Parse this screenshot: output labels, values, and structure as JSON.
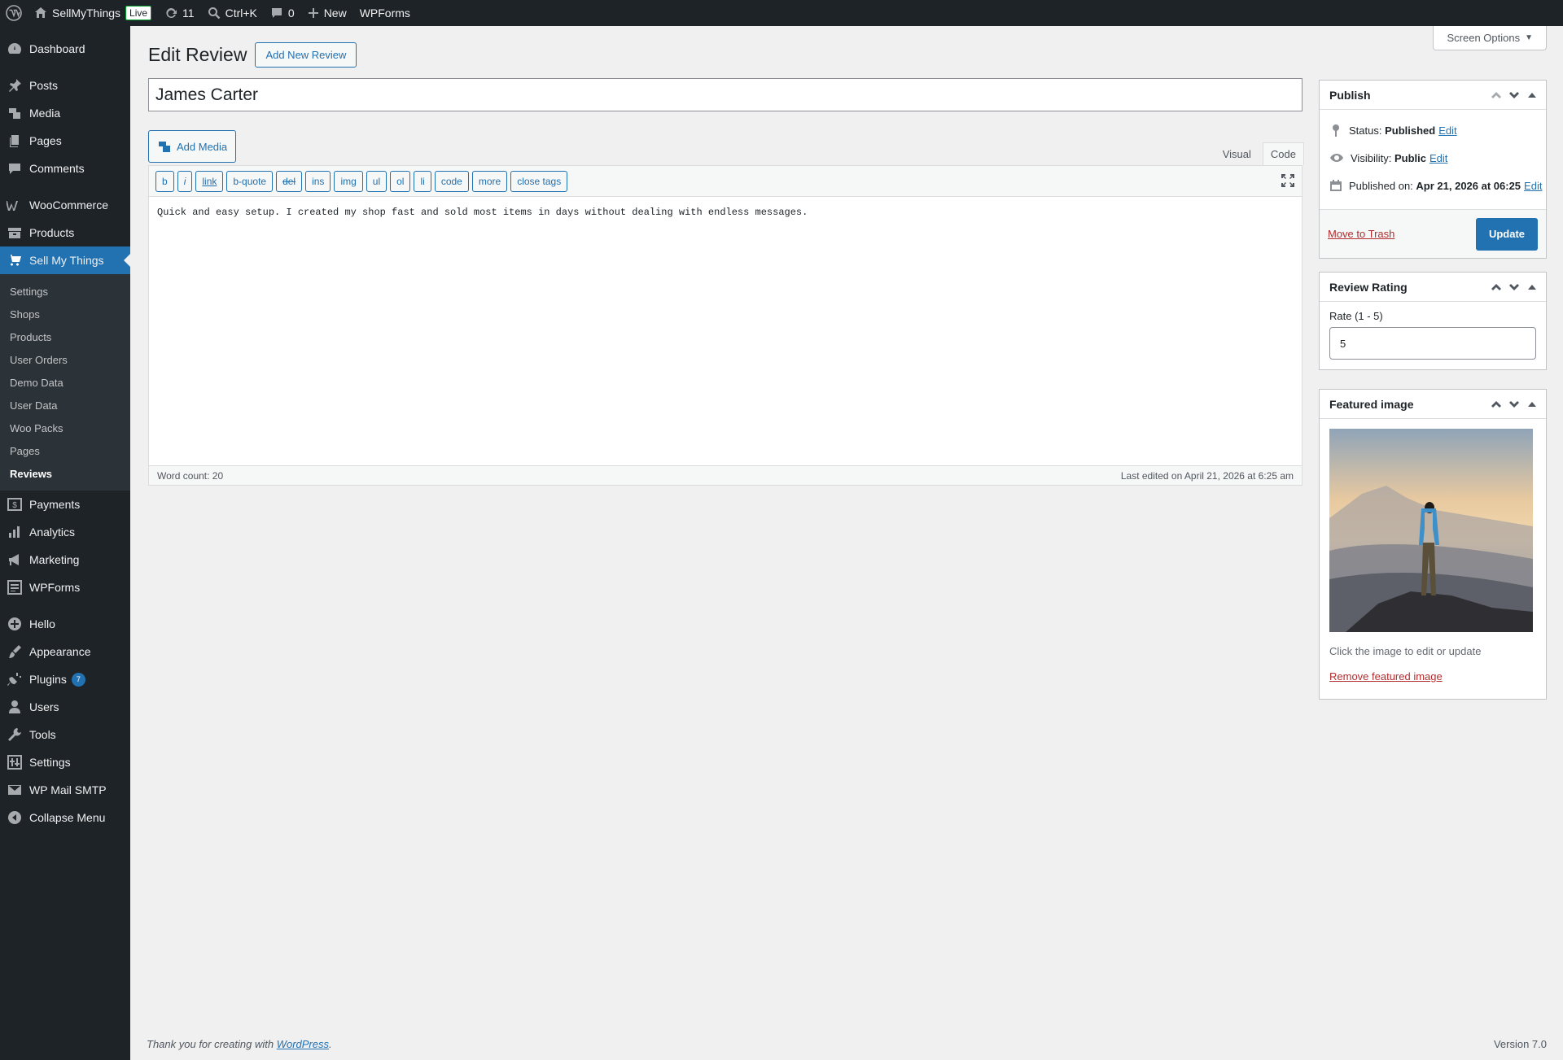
{
  "adminbar": {
    "site_name": "SellMyThings",
    "live_badge": "Live",
    "updates_count": "11",
    "search_shortcut": "Ctrl+K",
    "comments_count": "0",
    "new_label": "New",
    "wpforms_label": "WPForms"
  },
  "sidebar": {
    "items": [
      {
        "label": "Dashboard",
        "icon": "dashboard-icon"
      },
      {
        "label": "Posts",
        "icon": "pin-icon"
      },
      {
        "label": "Media",
        "icon": "media-icon"
      },
      {
        "label": "Pages",
        "icon": "pages-icon"
      },
      {
        "label": "Comments",
        "icon": "comments-icon"
      },
      {
        "label": "WooCommerce",
        "icon": "woocommerce-icon"
      },
      {
        "label": "Products",
        "icon": "archive-icon"
      },
      {
        "label": "Sell My Things",
        "icon": "cart-icon"
      },
      {
        "label": "Payments",
        "icon": "dollar-icon"
      },
      {
        "label": "Analytics",
        "icon": "chart-icon"
      },
      {
        "label": "Marketing",
        "icon": "megaphone-icon"
      },
      {
        "label": "WPForms",
        "icon": "forms-icon"
      },
      {
        "label": "Hello",
        "icon": "plus-circle-icon"
      },
      {
        "label": "Appearance",
        "icon": "brush-icon"
      },
      {
        "label": "Plugins",
        "icon": "plugin-icon",
        "badge": "7"
      },
      {
        "label": "Users",
        "icon": "users-icon"
      },
      {
        "label": "Tools",
        "icon": "wrench-icon"
      },
      {
        "label": "Settings",
        "icon": "settings-icon"
      },
      {
        "label": "WP Mail SMTP",
        "icon": "mail-icon"
      },
      {
        "label": "Collapse Menu",
        "icon": "collapse-icon"
      }
    ],
    "submenu": [
      "Settings",
      "Shops",
      "Products",
      "User Orders",
      "Demo Data",
      "User Data",
      "Woo Packs",
      "Pages",
      "Reviews"
    ]
  },
  "screen_options": "Screen Options",
  "page": {
    "title": "Edit Review",
    "add_new": "Add New Review",
    "post_title": "James Carter"
  },
  "editor": {
    "add_media": "Add Media",
    "tab_visual": "Visual",
    "tab_code": "Code",
    "buttons": [
      "b",
      "i",
      "link",
      "b-quote",
      "del",
      "ins",
      "img",
      "ul",
      "ol",
      "li",
      "code",
      "more",
      "close tags"
    ],
    "content": "Quick and easy setup. I created my shop fast and sold most items in days without dealing with endless messages.",
    "word_count": "Word count: 20",
    "last_edited": "Last edited on April 21, 2026 at 6:25 am"
  },
  "publish": {
    "title": "Publish",
    "status_label": "Status:",
    "status_value": "Published",
    "visibility_label": "Visibility:",
    "visibility_value": "Public",
    "published_label": "Published on:",
    "published_value": "Apr 21, 2026 at 06:25",
    "edit": "Edit",
    "trash": "Move to Trash",
    "update": "Update"
  },
  "rating": {
    "title": "Review Rating",
    "label": "Rate (1 - 5)",
    "value": "5"
  },
  "featured": {
    "title": "Featured image",
    "hint": "Click the image to edit or update",
    "remove": "Remove featured image"
  },
  "footer": {
    "thanks_prefix": "Thank you for creating with ",
    "wordpress": "WordPress",
    "thanks_suffix": ".",
    "version": "Version 7.0"
  }
}
